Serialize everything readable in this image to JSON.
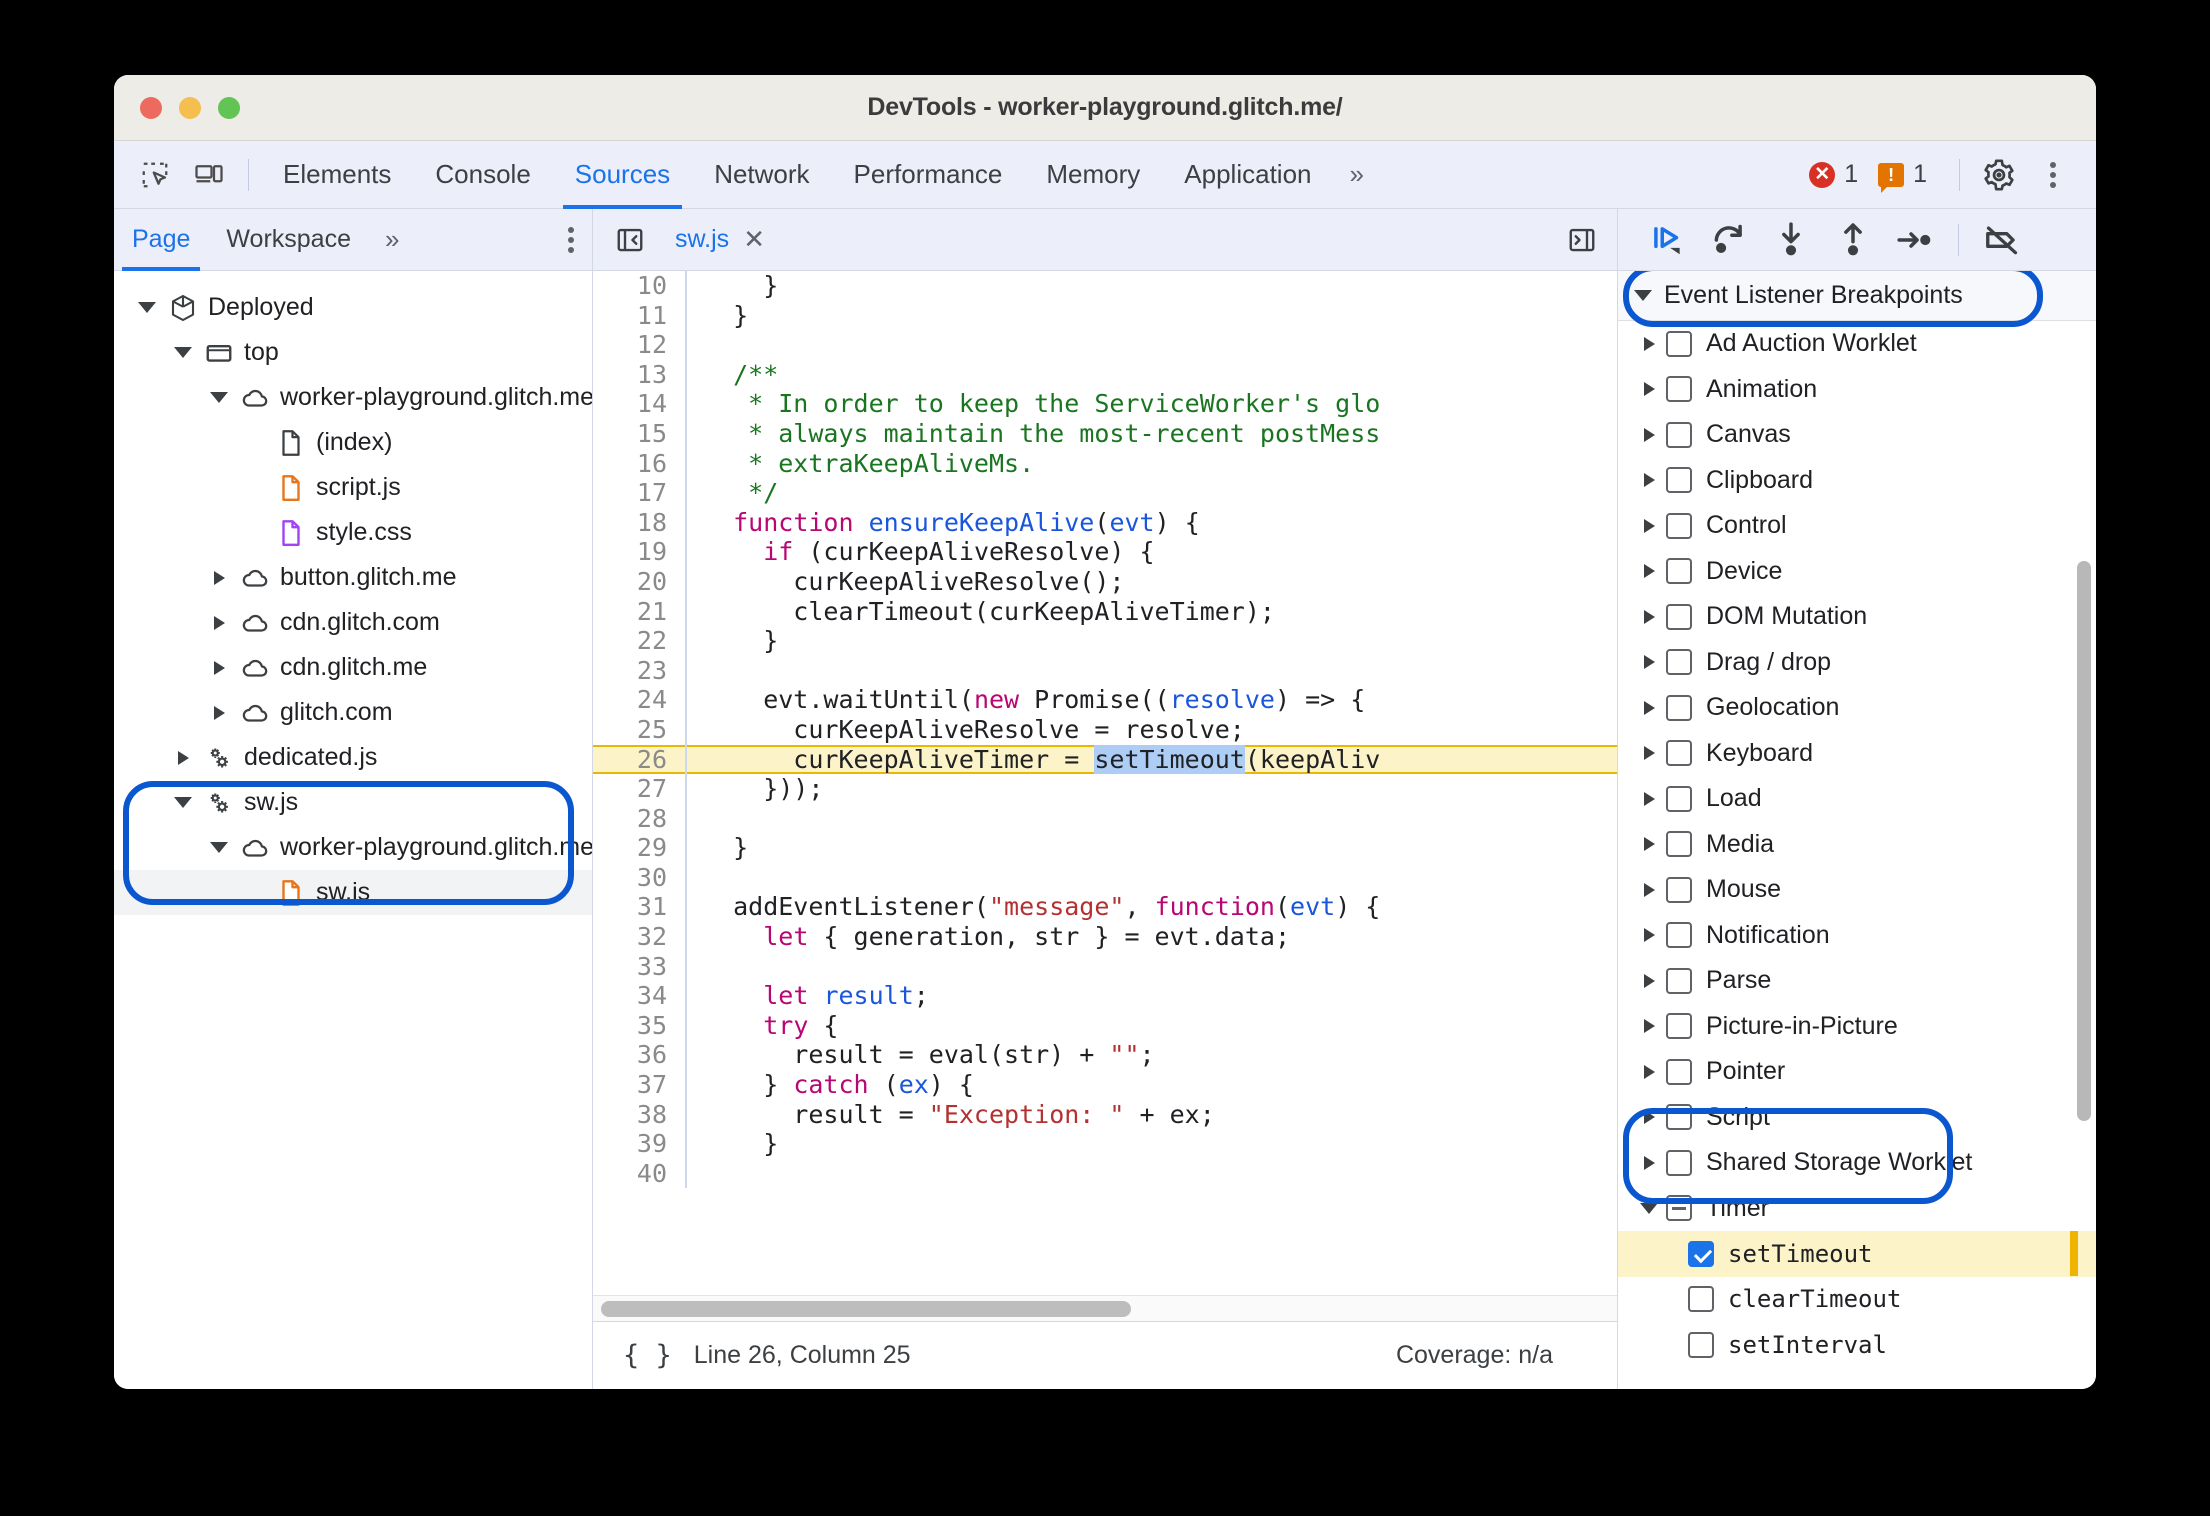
{
  "window": {
    "title": "DevTools - worker-playground.glitch.me/"
  },
  "main_tabs": {
    "inspect_icon": "inspect-element-icon",
    "device_icon": "device-toolbar-icon",
    "items": [
      {
        "label": "Elements",
        "active": false
      },
      {
        "label": "Console",
        "active": false
      },
      {
        "label": "Sources",
        "active": true
      },
      {
        "label": "Network",
        "active": false
      },
      {
        "label": "Performance",
        "active": false
      },
      {
        "label": "Memory",
        "active": false
      },
      {
        "label": "Application",
        "active": false
      }
    ],
    "overflow_label": "»",
    "error_count": "1",
    "warning_count": "1",
    "settings_icon": "gear-icon",
    "more_icon": "kebab-menu-icon"
  },
  "navigator_toolbar": {
    "tabs": [
      {
        "label": "Page",
        "active": true
      },
      {
        "label": "Workspace",
        "active": false
      }
    ],
    "overflow_label": "»",
    "more_icon": "kebab-menu-icon"
  },
  "editor_toolbar": {
    "collapse_icon": "collapse-navigator-icon",
    "file_tab": "sw.js",
    "close_icon": "close-tab-icon",
    "expand_icon": "show-sidebar-icon"
  },
  "debug_toolbar": {
    "buttons": [
      {
        "name": "resume-script-execution",
        "icon": "play-pause-icon"
      },
      {
        "name": "step-over-next-function-call",
        "icon": "step-over-icon"
      },
      {
        "name": "step-into-next-function-call",
        "icon": "step-into-icon"
      },
      {
        "name": "step-out-of-current-function",
        "icon": "step-out-icon"
      },
      {
        "name": "step",
        "icon": "step-icon"
      },
      {
        "name": "deactivate-breakpoints",
        "icon": "deactivate-breakpoints-icon"
      }
    ]
  },
  "file_tree": [
    {
      "label": "Deployed",
      "indent": 0,
      "twisty": "open",
      "icon": "package-icon",
      "selected": false
    },
    {
      "label": "top",
      "indent": 1,
      "twisty": "open",
      "icon": "frame-icon",
      "selected": false
    },
    {
      "label": "worker-playground.glitch.me",
      "indent": 2,
      "twisty": "open",
      "icon": "cloud-icon",
      "selected": false
    },
    {
      "label": "(index)",
      "indent": 3,
      "twisty": "none",
      "icon": "document-icon",
      "selected": false
    },
    {
      "label": "script.js",
      "indent": 3,
      "twisty": "none",
      "icon": "js-file-icon",
      "selected": false
    },
    {
      "label": "style.css",
      "indent": 3,
      "twisty": "none",
      "icon": "css-file-icon",
      "selected": false
    },
    {
      "label": "button.glitch.me",
      "indent": 2,
      "twisty": "closed",
      "icon": "cloud-icon",
      "selected": false
    },
    {
      "label": "cdn.glitch.com",
      "indent": 2,
      "twisty": "closed",
      "icon": "cloud-icon",
      "selected": false
    },
    {
      "label": "cdn.glitch.me",
      "indent": 2,
      "twisty": "closed",
      "icon": "cloud-icon",
      "selected": false
    },
    {
      "label": "glitch.com",
      "indent": 2,
      "twisty": "closed",
      "icon": "cloud-icon",
      "selected": false
    },
    {
      "label": "dedicated.js",
      "indent": 1,
      "twisty": "closed",
      "icon": "worker-icon",
      "selected": false
    },
    {
      "label": "sw.js",
      "indent": 1,
      "twisty": "open",
      "icon": "worker-icon",
      "selected": false
    },
    {
      "label": "worker-playground.glitch.me",
      "indent": 2,
      "twisty": "open",
      "icon": "cloud-icon",
      "selected": false
    },
    {
      "label": "sw.js",
      "indent": 3,
      "twisty": "none",
      "icon": "js-file-icon",
      "selected": true
    }
  ],
  "code": {
    "first_visible_line": 10,
    "highlight_line": 26,
    "lines": [
      {
        "n": 10,
        "tokens": [
          {
            "t": "    }",
            "c": ""
          }
        ]
      },
      {
        "n": 11,
        "tokens": [
          {
            "t": "  }",
            "c": ""
          }
        ]
      },
      {
        "n": 12,
        "tokens": [
          {
            "t": "",
            "c": ""
          }
        ]
      },
      {
        "n": 13,
        "tokens": [
          {
            "t": "  /**",
            "c": "k-com"
          }
        ]
      },
      {
        "n": 14,
        "tokens": [
          {
            "t": "   * In order to keep the ServiceWorker's glo",
            "c": "k-com"
          }
        ]
      },
      {
        "n": 15,
        "tokens": [
          {
            "t": "   * always maintain the most-recent postMess",
            "c": "k-com"
          }
        ]
      },
      {
        "n": 16,
        "tokens": [
          {
            "t": "   * extraKeepAliveMs.",
            "c": "k-com"
          }
        ]
      },
      {
        "n": 17,
        "tokens": [
          {
            "t": "   */",
            "c": "k-com"
          }
        ]
      },
      {
        "n": 18,
        "tokens": [
          {
            "t": "  ",
            "c": ""
          },
          {
            "t": "function",
            "c": "k-kw"
          },
          {
            "t": " ",
            "c": ""
          },
          {
            "t": "ensureKeepAlive",
            "c": "k-fn"
          },
          {
            "t": "(",
            "c": ""
          },
          {
            "t": "evt",
            "c": "k-var"
          },
          {
            "t": ") {",
            "c": ""
          }
        ]
      },
      {
        "n": 19,
        "tokens": [
          {
            "t": "    ",
            "c": ""
          },
          {
            "t": "if",
            "c": "k-kw"
          },
          {
            "t": " (curKeepAliveResolve) {",
            "c": ""
          }
        ]
      },
      {
        "n": 20,
        "tokens": [
          {
            "t": "      curKeepAliveResolve();",
            "c": ""
          }
        ]
      },
      {
        "n": 21,
        "tokens": [
          {
            "t": "      clearTimeout(curKeepAliveTimer);",
            "c": ""
          }
        ]
      },
      {
        "n": 22,
        "tokens": [
          {
            "t": "    }",
            "c": ""
          }
        ]
      },
      {
        "n": 23,
        "tokens": [
          {
            "t": "",
            "c": ""
          }
        ]
      },
      {
        "n": 24,
        "tokens": [
          {
            "t": "    evt.waitUntil(",
            "c": ""
          },
          {
            "t": "new",
            "c": "k-kw"
          },
          {
            "t": " Promise((",
            "c": ""
          },
          {
            "t": "resolve",
            "c": "k-var"
          },
          {
            "t": ") => {",
            "c": ""
          }
        ]
      },
      {
        "n": 25,
        "tokens": [
          {
            "t": "      curKeepAliveResolve = resolve;",
            "c": ""
          }
        ]
      },
      {
        "n": 26,
        "tokens": [
          {
            "t": "      curKeepAliveTimer = ",
            "c": ""
          },
          {
            "t": "setTimeout",
            "c": "k-sel"
          },
          {
            "t": "(keepAliv",
            "c": ""
          }
        ]
      },
      {
        "n": 27,
        "tokens": [
          {
            "t": "    }));",
            "c": ""
          }
        ]
      },
      {
        "n": 28,
        "tokens": [
          {
            "t": "",
            "c": ""
          }
        ]
      },
      {
        "n": 29,
        "tokens": [
          {
            "t": "  }",
            "c": ""
          }
        ]
      },
      {
        "n": 30,
        "tokens": [
          {
            "t": "",
            "c": ""
          }
        ]
      },
      {
        "n": 31,
        "tokens": [
          {
            "t": "  addEventListener(",
            "c": ""
          },
          {
            "t": "\"message\"",
            "c": "k-str"
          },
          {
            "t": ", ",
            "c": ""
          },
          {
            "t": "function",
            "c": "k-kw"
          },
          {
            "t": "(",
            "c": ""
          },
          {
            "t": "evt",
            "c": "k-var"
          },
          {
            "t": ") {",
            "c": ""
          }
        ]
      },
      {
        "n": 32,
        "tokens": [
          {
            "t": "    ",
            "c": ""
          },
          {
            "t": "let",
            "c": "k-kw"
          },
          {
            "t": " { generation, str } = evt.data;",
            "c": ""
          }
        ]
      },
      {
        "n": 33,
        "tokens": [
          {
            "t": "",
            "c": ""
          }
        ]
      },
      {
        "n": 34,
        "tokens": [
          {
            "t": "    ",
            "c": ""
          },
          {
            "t": "let",
            "c": "k-kw"
          },
          {
            "t": " ",
            "c": ""
          },
          {
            "t": "result",
            "c": "k-var"
          },
          {
            "t": ";",
            "c": ""
          }
        ]
      },
      {
        "n": 35,
        "tokens": [
          {
            "t": "    ",
            "c": ""
          },
          {
            "t": "try",
            "c": "k-kw"
          },
          {
            "t": " {",
            "c": ""
          }
        ]
      },
      {
        "n": 36,
        "tokens": [
          {
            "t": "      result = eval(str) + ",
            "c": ""
          },
          {
            "t": "\"\"",
            "c": "k-str"
          },
          {
            "t": ";",
            "c": ""
          }
        ]
      },
      {
        "n": 37,
        "tokens": [
          {
            "t": "    } ",
            "c": ""
          },
          {
            "t": "catch",
            "c": "k-kw"
          },
          {
            "t": " (",
            "c": ""
          },
          {
            "t": "ex",
            "c": "k-var"
          },
          {
            "t": ") {",
            "c": ""
          }
        ]
      },
      {
        "n": 38,
        "tokens": [
          {
            "t": "      result = ",
            "c": ""
          },
          {
            "t": "\"Exception: \"",
            "c": "k-str"
          },
          {
            "t": " + ex;",
            "c": ""
          }
        ]
      },
      {
        "n": 39,
        "tokens": [
          {
            "t": "    }",
            "c": ""
          }
        ]
      },
      {
        "n": 40,
        "tokens": [
          {
            "t": "",
            "c": ""
          }
        ]
      }
    ]
  },
  "statusbar": {
    "format_icon": "pretty-print-braces-icon",
    "position": "Line 26, Column 25",
    "coverage": "Coverage: n/a"
  },
  "sidebar": {
    "section_title": "Event Listener Breakpoints",
    "section_expanded": true,
    "items": [
      {
        "label": "Ad Auction Worklet",
        "state": "unchecked",
        "expanded": false,
        "child": false
      },
      {
        "label": "Animation",
        "state": "unchecked",
        "expanded": false,
        "child": false
      },
      {
        "label": "Canvas",
        "state": "unchecked",
        "expanded": false,
        "child": false
      },
      {
        "label": "Clipboard",
        "state": "unchecked",
        "expanded": false,
        "child": false
      },
      {
        "label": "Control",
        "state": "unchecked",
        "expanded": false,
        "child": false
      },
      {
        "label": "Device",
        "state": "unchecked",
        "expanded": false,
        "child": false
      },
      {
        "label": "DOM Mutation",
        "state": "unchecked",
        "expanded": false,
        "child": false
      },
      {
        "label": "Drag / drop",
        "state": "unchecked",
        "expanded": false,
        "child": false
      },
      {
        "label": "Geolocation",
        "state": "unchecked",
        "expanded": false,
        "child": false
      },
      {
        "label": "Keyboard",
        "state": "unchecked",
        "expanded": false,
        "child": false
      },
      {
        "label": "Load",
        "state": "unchecked",
        "expanded": false,
        "child": false
      },
      {
        "label": "Media",
        "state": "unchecked",
        "expanded": false,
        "child": false
      },
      {
        "label": "Mouse",
        "state": "unchecked",
        "expanded": false,
        "child": false
      },
      {
        "label": "Notification",
        "state": "unchecked",
        "expanded": false,
        "child": false
      },
      {
        "label": "Parse",
        "state": "unchecked",
        "expanded": false,
        "child": false
      },
      {
        "label": "Picture-in-Picture",
        "state": "unchecked",
        "expanded": false,
        "child": false
      },
      {
        "label": "Pointer",
        "state": "unchecked",
        "expanded": false,
        "child": false
      },
      {
        "label": "Script",
        "state": "unchecked",
        "expanded": false,
        "child": false
      },
      {
        "label": "Shared Storage Worklet",
        "state": "unchecked",
        "expanded": false,
        "child": false
      },
      {
        "label": "Timer",
        "state": "indeterminate",
        "expanded": true,
        "child": false
      },
      {
        "label": "setTimeout",
        "state": "checked",
        "expanded": false,
        "child": true,
        "highlighted": true
      },
      {
        "label": "clearTimeout",
        "state": "unchecked",
        "expanded": false,
        "child": true
      },
      {
        "label": "setInterval",
        "state": "unchecked",
        "expanded": false,
        "child": true
      }
    ]
  },
  "annotations": {
    "accent_color": "#0b57d0",
    "highlight_color": "#fdf3c8",
    "callouts": [
      {
        "name": "sw-js-tree-callout"
      },
      {
        "name": "event-listener-breakpoints-header-callout"
      },
      {
        "name": "timer-settimeout-callout"
      }
    ]
  }
}
